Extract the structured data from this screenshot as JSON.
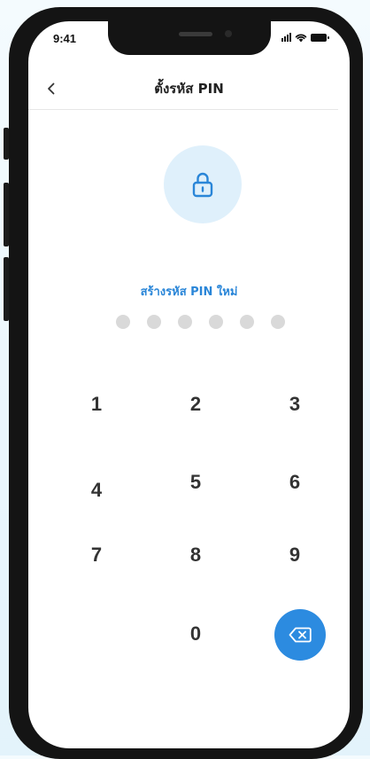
{
  "status_bar": {
    "time": "9:41"
  },
  "header": {
    "back_icon": "chevron-left-icon",
    "title": "ตั้งรหัส PIN"
  },
  "lock": {
    "icon": "lock-icon"
  },
  "prompt": "สร้างรหัส PIN ใหม่",
  "pin": {
    "length": 6,
    "entered": 0
  },
  "keypad": {
    "keys": [
      "1",
      "2",
      "3",
      "4",
      "5",
      "6",
      "7",
      "8",
      "9",
      "0"
    ],
    "delete_icon": "backspace-icon"
  },
  "colors": {
    "accent": "#2c8be0",
    "prompt_text": "#2a86d8",
    "lock_bg": "#dff0fb",
    "dot_empty": "#d9d9d9"
  }
}
